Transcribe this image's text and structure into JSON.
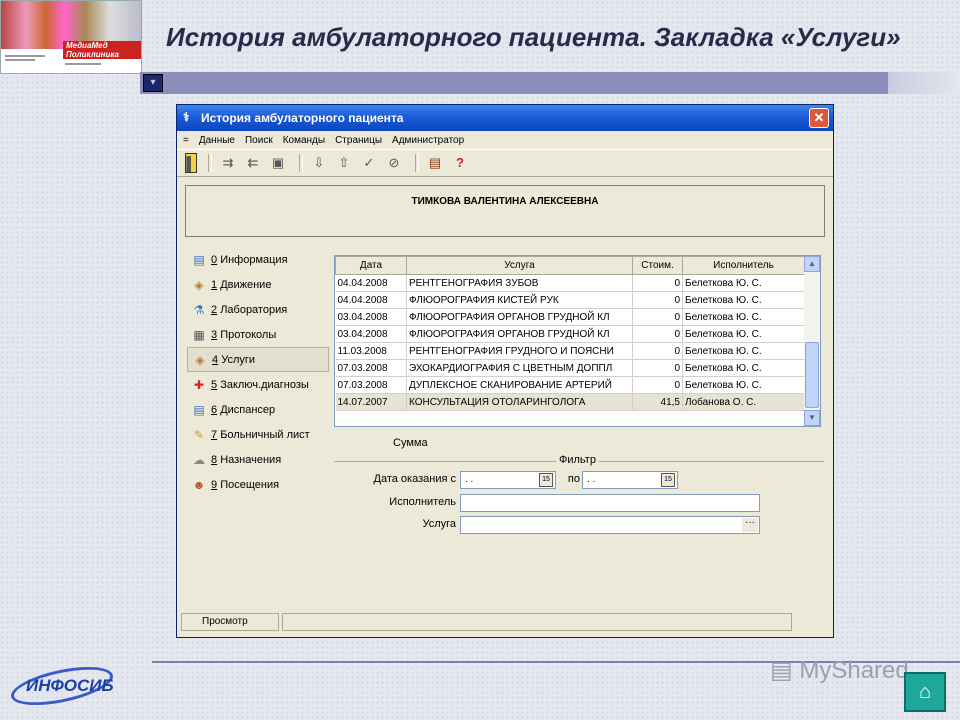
{
  "slide": {
    "title": "История амбулаторного пациента. Закладка «Услуги»",
    "thumb_brand": "МедиаМед Поликлиника",
    "logo_text": "ИНФОСИБ",
    "watermark": "MyShared"
  },
  "window": {
    "title": "История амбулаторного пациента",
    "close_glyph": "✕",
    "menu": [
      "=",
      "Данные",
      "Поиск",
      "Команды",
      "Страницы",
      "Администратор"
    ],
    "patient_name": "ТИМКОВА ВАЛЕНТИНА АЛЕКСЕЕВНА",
    "nav": [
      {
        "num": "0",
        "label": "Информация",
        "icon": "info-icon"
      },
      {
        "num": "1",
        "label": "Движение",
        "icon": "movement-icon"
      },
      {
        "num": "2",
        "label": "Лаборатория",
        "icon": "lab-icon"
      },
      {
        "num": "3",
        "label": "Протоколы",
        "icon": "protocols-icon"
      },
      {
        "num": "4",
        "label": "Услуги",
        "icon": "services-icon"
      },
      {
        "num": "5",
        "label": "Заключ.диагнозы",
        "icon": "diagnosis-icon"
      },
      {
        "num": "6",
        "label": "Диспансер",
        "icon": "dispensary-icon"
      },
      {
        "num": "7",
        "label": "Больничный лист",
        "icon": "sick-leave-icon"
      },
      {
        "num": "8",
        "label": "Назначения",
        "icon": "prescriptions-icon"
      },
      {
        "num": "9",
        "label": "Посещения",
        "icon": "visits-icon"
      }
    ],
    "active_nav": 4,
    "table": {
      "columns": [
        "Дата",
        "Услуга",
        "Стоим.",
        "Исполнитель"
      ],
      "rows": [
        [
          "04.04.2008",
          "РЕНТГЕНОГРАФИЯ ЗУБОВ",
          "0",
          "Белеткова Ю. С."
        ],
        [
          "04.04.2008",
          "ФЛЮОРОГРАФИЯ КИСТЕЙ РУК",
          "0",
          "Белеткова Ю. С."
        ],
        [
          "03.04.2008",
          "ФЛЮОРОГРАФИЯ ОРГАНОВ ГРУДНОЙ КЛ",
          "0",
          "Белеткова Ю. С."
        ],
        [
          "03.04.2008",
          "ФЛЮОРОГРАФИЯ ОРГАНОВ ГРУДНОЙ КЛ",
          "0",
          "Белеткова Ю. С."
        ],
        [
          "11.03.2008",
          "РЕНТГЕНОГРАФИЯ ГРУДНОГО И ПОЯСНИ",
          "0",
          "Белеткова Ю. С."
        ],
        [
          "07.03.2008",
          "ЭХОКАРДИОГРАФИЯ С ЦВЕТНЫМ ДОППЛ",
          "0",
          "Белеткова Ю. С."
        ],
        [
          "07.03.2008",
          "ДУПЛЕКСНОЕ СКАНИРОВАНИЕ АРТЕРИЙ",
          "0",
          "Белеткова Ю. С."
        ],
        [
          "14.07.2007",
          "КОНСУЛЬТАЦИЯ ОТОЛАРИНГОЛОГА",
          "41,5",
          "Лобанова О. С."
        ]
      ],
      "selected_row": 7
    },
    "sum_label": "Сумма",
    "filter": {
      "legend": "Фильтр",
      "date_from_label": "Дата оказания с",
      "date_from_value": ". .",
      "date_to_label": "по",
      "date_to_value": ". .",
      "calendar_glyph": "15",
      "executor_label": "Исполнитель",
      "executor_value": "",
      "service_label": "Услуга",
      "service_value": "",
      "ellipsis": "···"
    },
    "status": [
      "Просмотр",
      ""
    ]
  }
}
